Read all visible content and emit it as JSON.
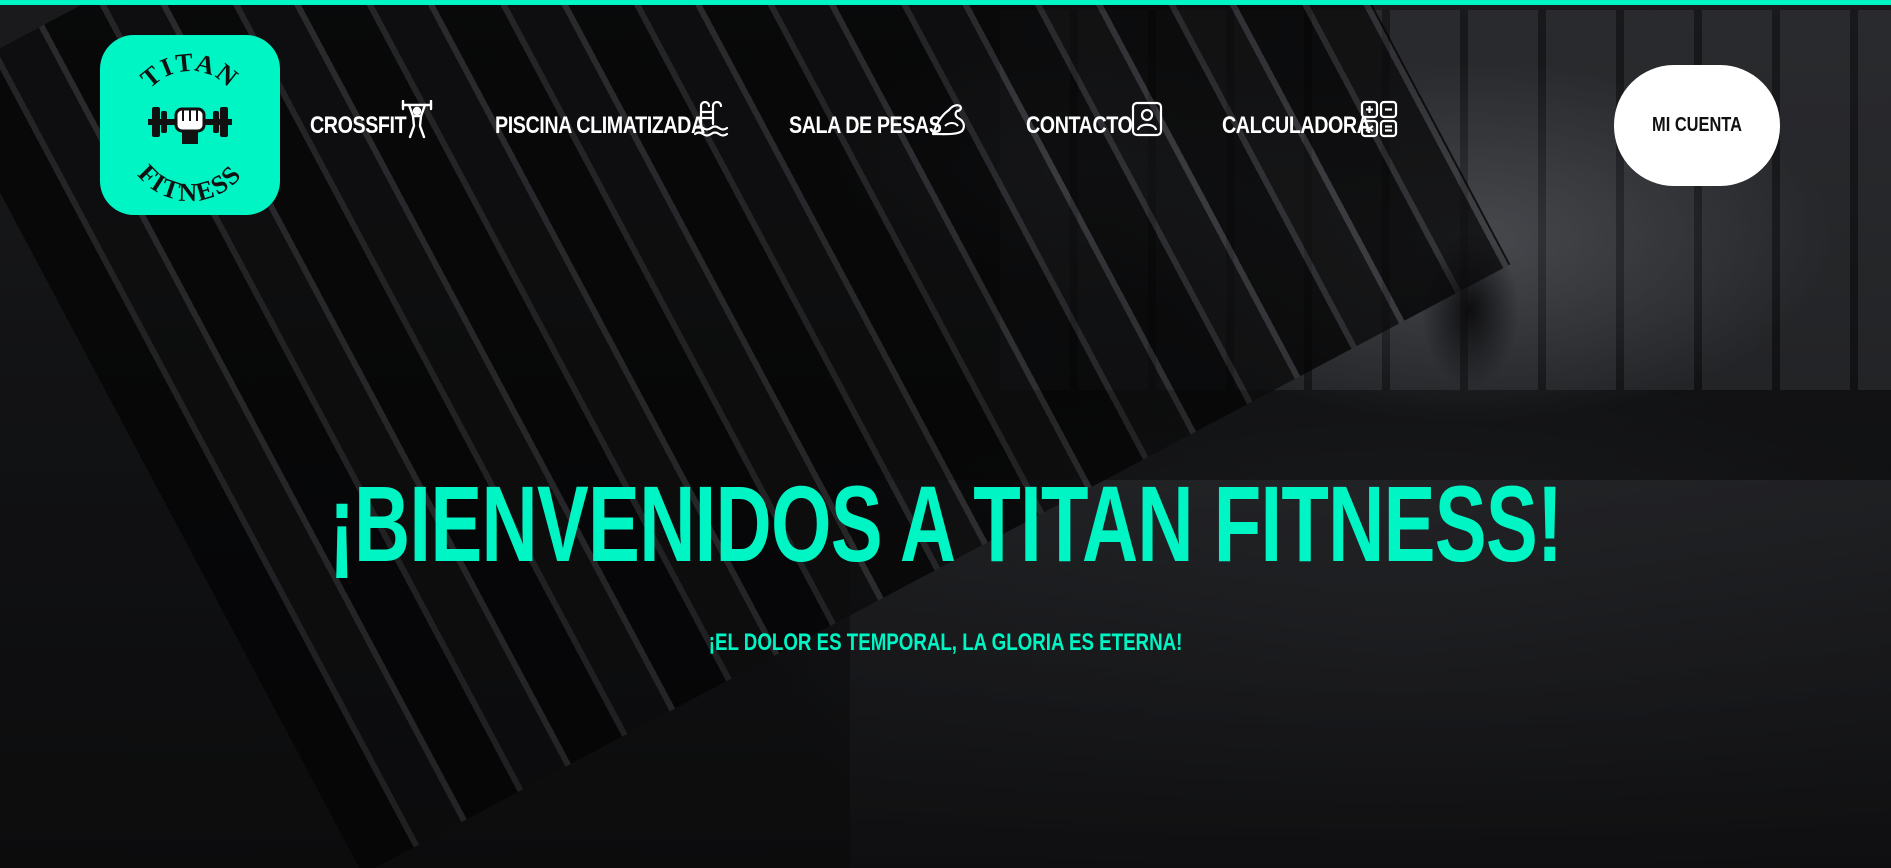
{
  "theme": {
    "accent": "#00f5c4",
    "button_bg": "#ffffff",
    "text": "#ffffff"
  },
  "logo": {
    "line1": "TITAN",
    "line2": "FITNESS",
    "icon": "fist-dumbbell-icon"
  },
  "nav": {
    "items": [
      {
        "label": "CROSSFIT",
        "icon": "weightlifter-icon"
      },
      {
        "label": "PISCINA CLIMATIZADA",
        "icon": "pool-ladder-icon"
      },
      {
        "label": "SALA DE PESAS",
        "icon": "flexed-arm-icon"
      },
      {
        "label": "CONTACTO",
        "icon": "contact-card-icon"
      },
      {
        "label": "CALCULADORA",
        "icon": "calculator-icon"
      }
    ]
  },
  "account": {
    "label": "MI CUENTA"
  },
  "hero": {
    "title": "¡BIENVENIDOS A TITAN FITNESS!",
    "subtitle": "¡EL DOLOR ES TEMPORAL, LA GLORIA ES ETERNA!"
  }
}
